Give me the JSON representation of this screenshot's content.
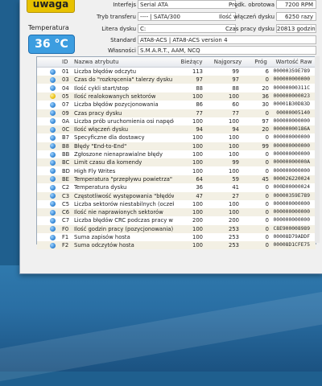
{
  "status": {
    "label": "uwaga",
    "color": "#e8c200"
  },
  "temperature": {
    "label": "Temperatura",
    "value": "36 °C",
    "color": "#3c9de0"
  },
  "info_left": {
    "interface_label": "Interfejs",
    "interface_value": "Serial ATA",
    "transfer_label": "Tryb transferu",
    "transfer_value": "---- | SATA/300",
    "letter_label": "Litera dysku",
    "letter_value": "C:",
    "standard_label": "Standard",
    "standard_value": "ATA8-ACS | ATA8-ACS version 4",
    "features_label": "Własności",
    "features_value": "S.M.A.R.T., AAM, NCQ"
  },
  "info_right": {
    "rpm_label": "Prędk. obrotowa",
    "rpm_value": "7200 RPM",
    "power_count_label": "Ilość włączeń dysku",
    "power_count_value": "6250 razy",
    "hours_label": "Czas pracy dysku",
    "hours_value": "20813 godzin"
  },
  "table": {
    "headers": {
      "id": "ID",
      "name": "Nazwa atrybutu",
      "current": "Bieżący",
      "worst": "Najgorszy",
      "threshold": "Próg",
      "raw": "Wartość Raw"
    },
    "rows": [
      {
        "id": "01",
        "name": "Liczba błędów odczytu",
        "current": "113",
        "worst": "99",
        "threshold": "6",
        "raw": "00000359E789",
        "warn": false
      },
      {
        "id": "03",
        "name": "Czas do \"rozkręcenia\" talerzy dysku",
        "current": "97",
        "worst": "97",
        "threshold": "0",
        "raw": "000000000000",
        "warn": false
      },
      {
        "id": "04",
        "name": "Ilość cykli start/stop",
        "current": "88",
        "worst": "88",
        "threshold": "20",
        "raw": "00000000311C",
        "warn": false
      },
      {
        "id": "05",
        "name": "Ilość realokowanych sektorów",
        "current": "100",
        "worst": "100",
        "threshold": "36",
        "raw": "000000000023",
        "warn": true
      },
      {
        "id": "07",
        "name": "Liczba błędów pozycjonowania",
        "current": "86",
        "worst": "60",
        "threshold": "30",
        "raw": "00001B30D83D",
        "warn": false
      },
      {
        "id": "09",
        "name": "Czas pracy dysku",
        "current": "77",
        "worst": "77",
        "threshold": "0",
        "raw": "00000005140",
        "warn": false
      },
      {
        "id": "0A",
        "name": "Liczba prób uruchomienia osi napędowej...",
        "current": "100",
        "worst": "100",
        "threshold": "97",
        "raw": "000000000000",
        "warn": false
      },
      {
        "id": "0C",
        "name": "Ilość włączeń dysku",
        "current": "94",
        "worst": "94",
        "threshold": "20",
        "raw": "00000000186A",
        "warn": false
      },
      {
        "id": "B7",
        "name": "Specyficzne dla dostawcy",
        "current": "100",
        "worst": "100",
        "threshold": "0",
        "raw": "000000000000",
        "warn": false
      },
      {
        "id": "B8",
        "name": "Błędy \"End-to-End\"",
        "current": "100",
        "worst": "100",
        "threshold": "99",
        "raw": "000000000000",
        "warn": false
      },
      {
        "id": "BB",
        "name": "Zgłoszone nienaprawialne błędy",
        "current": "100",
        "worst": "100",
        "threshold": "0",
        "raw": "000000000000",
        "warn": false
      },
      {
        "id": "BC",
        "name": "Limit czasu dla komendy",
        "current": "100",
        "worst": "99",
        "threshold": "0",
        "raw": "00000000000A",
        "warn": false
      },
      {
        "id": "BD",
        "name": "High Fly Writes",
        "current": "100",
        "worst": "100",
        "threshold": "0",
        "raw": "000000000000",
        "warn": false
      },
      {
        "id": "BE",
        "name": "Temperatura \"przepływu powietrza\"",
        "current": "64",
        "worst": "59",
        "threshold": "45",
        "raw": "000026220024",
        "warn": false
      },
      {
        "id": "C2",
        "name": "Temperatura dysku",
        "current": "36",
        "worst": "41",
        "threshold": "0",
        "raw": "000D00000024",
        "warn": false
      },
      {
        "id": "C3",
        "name": "Częstotliwość występowania \"błędów w lo...",
        "current": "47",
        "worst": "27",
        "threshold": "0",
        "raw": "00000359E789",
        "warn": false
      },
      {
        "id": "C5",
        "name": "Liczba sektorów niestabilnych (oczekując...",
        "current": "100",
        "worst": "100",
        "threshold": "0",
        "raw": "000000000000",
        "warn": false
      },
      {
        "id": "C6",
        "name": "Ilość nie naprawionych sektorów",
        "current": "100",
        "worst": "100",
        "threshold": "0",
        "raw": "000000000000",
        "warn": false
      },
      {
        "id": "C7",
        "name": "Liczba błędów CRC podczas pracy w trybi...",
        "current": "200",
        "worst": "200",
        "threshold": "0",
        "raw": "000000000000",
        "warn": false
      },
      {
        "id": "F0",
        "name": "Ilość godzin pracy (pozycjonowania) gło...",
        "current": "100",
        "worst": "253",
        "threshold": "0",
        "raw": "C8E900008989",
        "warn": false
      },
      {
        "id": "F1",
        "name": "Suma zapisów hosta",
        "current": "100",
        "worst": "253",
        "threshold": "0",
        "raw": "00008D79ADDF",
        "warn": false
      },
      {
        "id": "F2",
        "name": "Suma odczytów hosta",
        "current": "100",
        "worst": "253",
        "threshold": "0",
        "raw": "00008D1CFE75",
        "warn": false
      }
    ]
  }
}
